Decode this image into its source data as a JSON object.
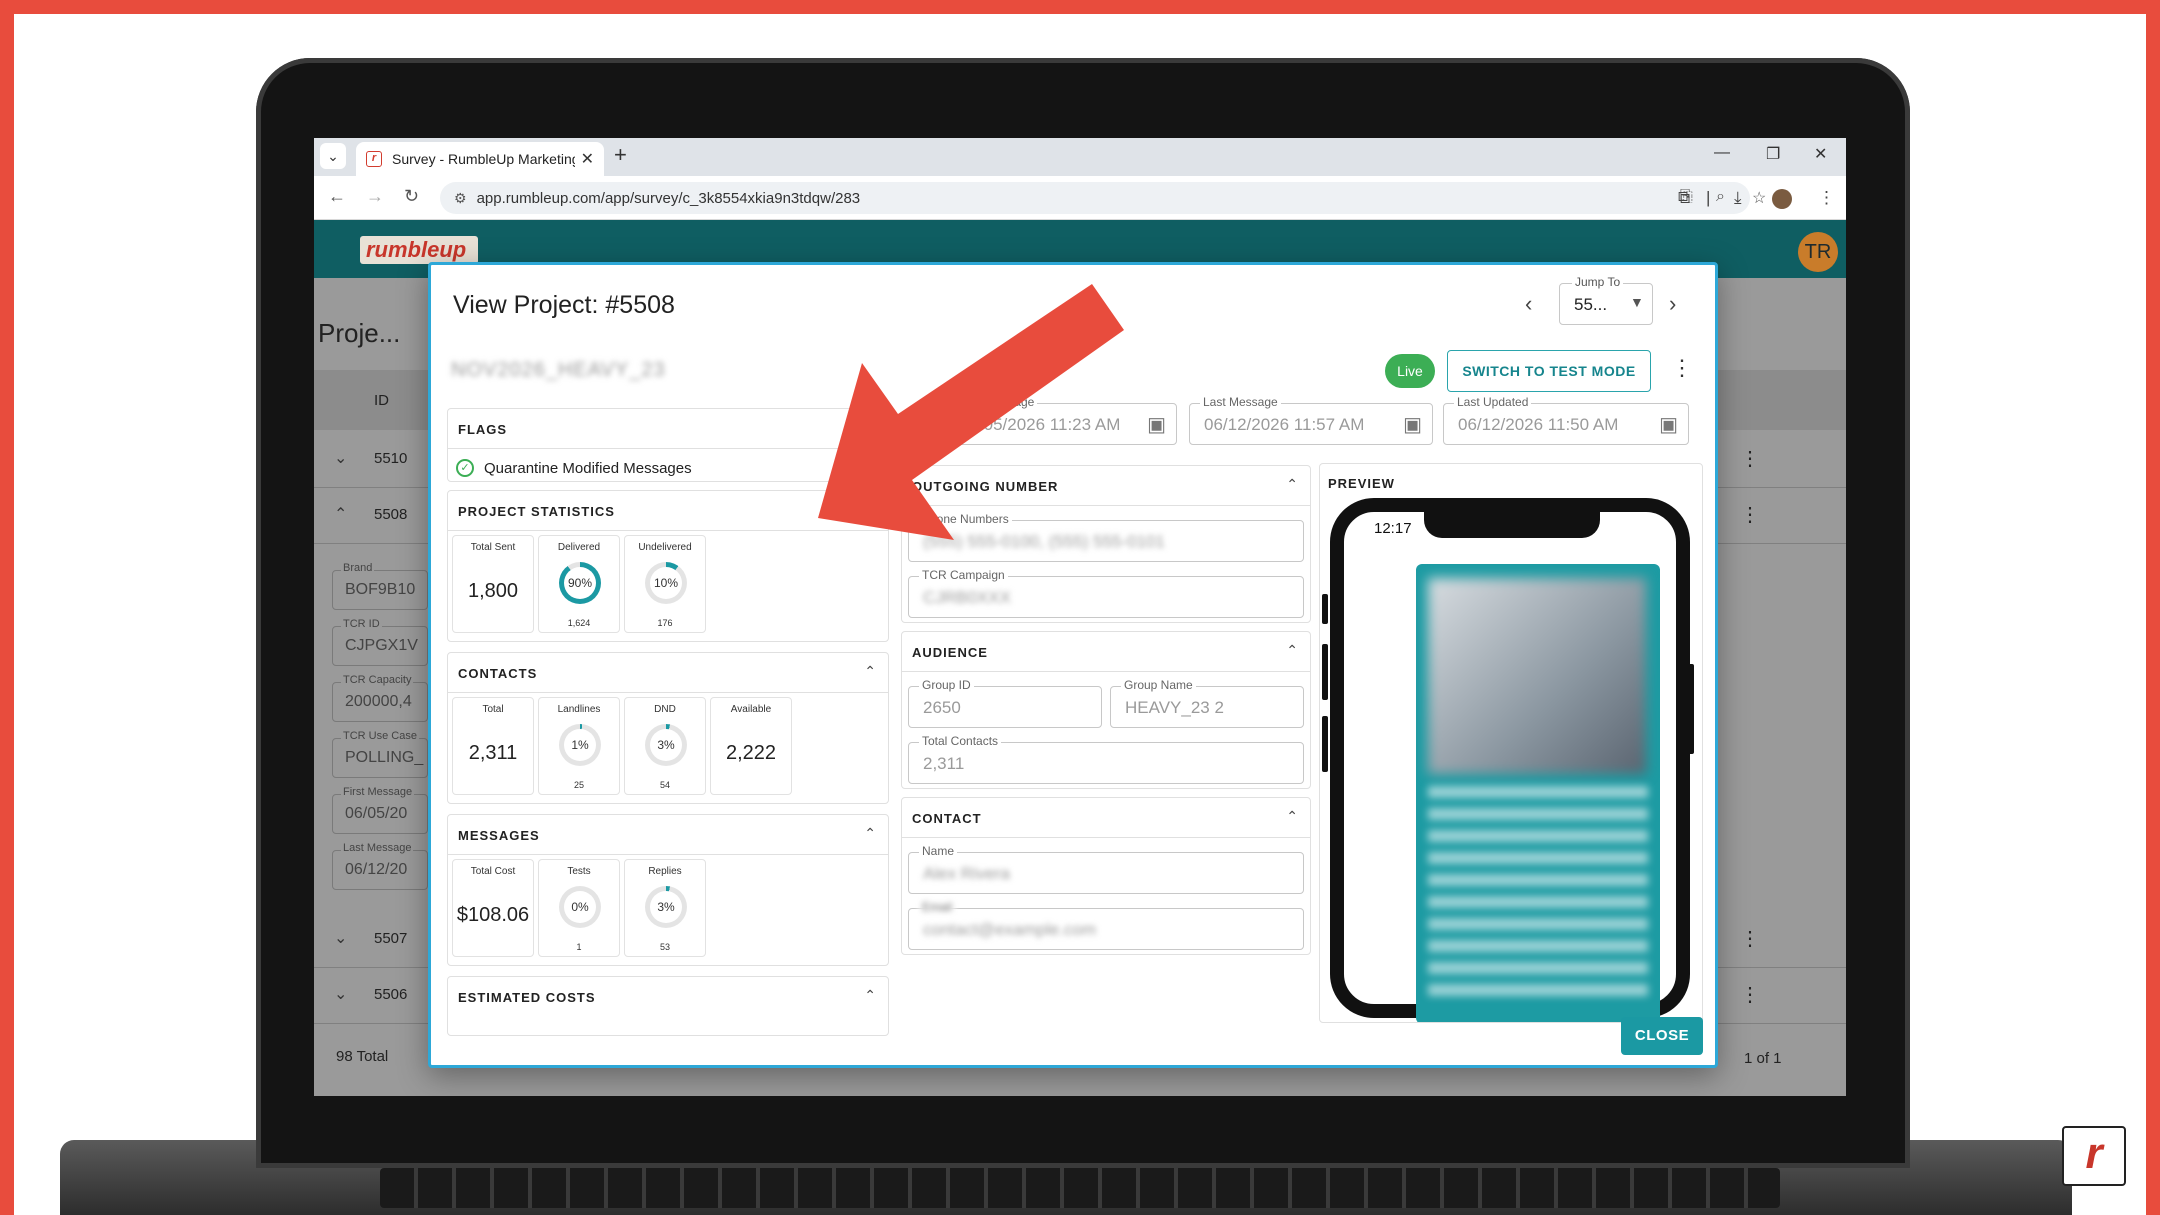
{
  "browser": {
    "tab_title": "Survey - RumbleUp Marketing",
    "url": "app.rumbleup.com/app/survey/c_3k8554xkia9n3tdqw/283"
  },
  "app": {
    "logo_text": "rumbleup",
    "page_title": "Proje...",
    "avatar_initials": "TR",
    "table_header_id": "ID",
    "rows": [
      {
        "id": "5510"
      },
      {
        "id": "5508"
      },
      {
        "id": "5507"
      },
      {
        "id": "5506"
      }
    ],
    "detail_fields": [
      {
        "label": "Brand",
        "value": "BOF9B10"
      },
      {
        "label": "TCR ID",
        "value": "CJPGX1V"
      },
      {
        "label": "TCR Capacity",
        "value": "200000,4"
      },
      {
        "label": "TCR Use Case",
        "value": "POLLING_"
      },
      {
        "label": "First Message",
        "value": "06/05/20"
      },
      {
        "label": "Last Message",
        "value": "06/12/20"
      }
    ],
    "total_text": "98 Total",
    "pager_text": "1 of 1"
  },
  "modal": {
    "title": "View Project: #5508",
    "jump_label": "Jump To",
    "jump_value": "55...",
    "project_name": "NOV2026_HEAVY_23",
    "live_label": "Live",
    "test_mode_label": "SWITCH TO TEST MODE",
    "dates": {
      "first_label": "First Message",
      "first_value": "06/05/2026 11:23 AM",
      "last_label": "Last Message",
      "last_value": "06/12/2026 11:57 AM",
      "updated_label": "Last Updated",
      "updated_value": "06/12/2026 11:50 AM"
    },
    "flags": {
      "title": "FLAGS",
      "item": "Quarantine Modified Messages"
    },
    "project_statistics": {
      "title": "PROJECT STATISTICS",
      "total_sent_label": "Total Sent",
      "total_sent": "1,800",
      "delivered_label": "Delivered",
      "delivered_pct": "90%",
      "delivered_fraction": 0.9,
      "delivered_count": "1,624",
      "undelivered_label": "Undelivered",
      "undelivered_pct": "10%",
      "undelivered_fraction": 0.1,
      "undelivered_count": "176"
    },
    "contacts": {
      "title": "CONTACTS",
      "total_label": "Total",
      "total": "2,311",
      "landlines_label": "Landlines",
      "landlines_pct": "1%",
      "landlines_fraction": 0.01,
      "landlines_count": "25",
      "dnd_label": "DND",
      "dnd_pct": "3%",
      "dnd_fraction": 0.03,
      "dnd_count": "54",
      "available_label": "Available",
      "available": "2,222"
    },
    "messages": {
      "title": "MESSAGES",
      "total_cost_label": "Total Cost",
      "total_cost": "$108.06",
      "tests_label": "Tests",
      "tests_pct": "0%",
      "tests_fraction": 0.0,
      "tests_count": "1",
      "replies_label": "Replies",
      "replies_pct": "3%",
      "replies_fraction": 0.03,
      "replies_count": "53"
    },
    "estimated_costs": {
      "title": "ESTIMATED COSTS"
    },
    "outgoing": {
      "title": "OUTGOING NUMBER",
      "phone_label": "Phone Numbers",
      "phone_value": "(555) 555-0100, (555) 555-0101",
      "tcr_label": "TCR Campaign",
      "tcr_value": "CJRB0XXX"
    },
    "audience": {
      "title": "AUDIENCE",
      "group_id_label": "Group ID",
      "group_id": "2650",
      "group_name_label": "Group Name",
      "group_name": "HEAVY_23 2",
      "total_contacts_label": "Total Contacts",
      "total_contacts": "2,311"
    },
    "contact": {
      "title": "CONTACT",
      "name_label": "Name",
      "name_value": "Alex Rivera",
      "email_label": "Email",
      "email_value": "contact@example.com"
    },
    "preview": {
      "title": "PREVIEW",
      "phone_time": "12:17"
    },
    "close_label": "CLOSE"
  },
  "colors": {
    "frame": "#e84c3d",
    "teal": "#1b99a3",
    "live": "#3cae55",
    "arrow": "#e84c3d"
  }
}
